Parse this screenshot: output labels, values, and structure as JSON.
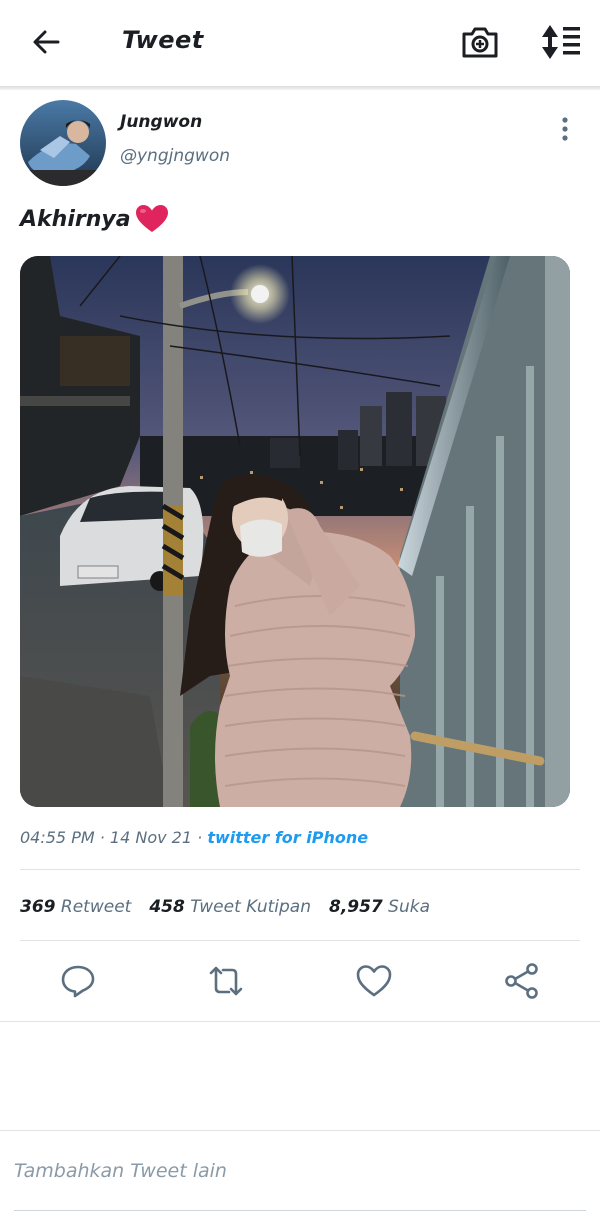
{
  "header": {
    "title": "Tweet"
  },
  "tweet": {
    "display_name": "Jungwon",
    "handle": "@yngjngwon",
    "text": "Akhirnya",
    "time": "04:55 PM",
    "date": "14 Nov 21",
    "source": "twitter for iPhone",
    "stats": {
      "retweets": "369",
      "retweets_label": "Retweet",
      "quotes": "458",
      "quotes_label": "Tweet Kutipan",
      "likes": "8,957",
      "likes_label": "Suka"
    }
  },
  "composer": {
    "placeholder": "Tambahkan Tweet lain"
  },
  "colors": {
    "accent": "#1d9bf0",
    "icon": "#5b6f80",
    "heart": "#e0245e"
  },
  "icons": [
    "back-arrow-icon",
    "camera-plus-icon",
    "sort-icon",
    "more-vertical-icon",
    "heart-emoji-icon",
    "reply-icon",
    "retweet-icon",
    "like-icon",
    "share-icon"
  ]
}
